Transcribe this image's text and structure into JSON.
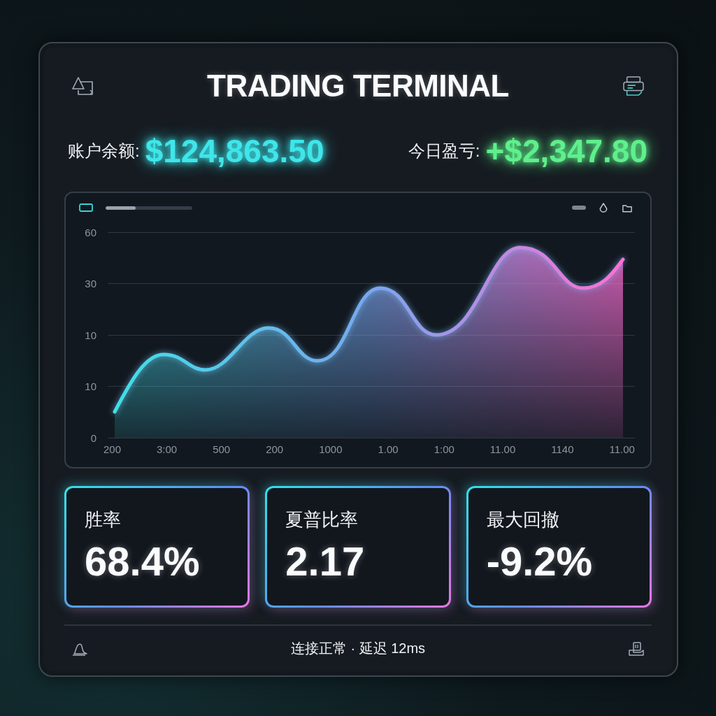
{
  "header": {
    "title": "TRADING TERMINAL"
  },
  "balances": [
    {
      "label": "账户余额:",
      "value": "$124,863.50",
      "color": "#3ee6ea"
    },
    {
      "label": "今日盈亏:",
      "value": "+$2,347.80",
      "color": "#5ef08c"
    }
  ],
  "chart": {
    "progress": {
      "level": 0.35
    },
    "y_labels": [
      "60",
      "30",
      "10",
      "10",
      "0"
    ],
    "x_labels": [
      "200",
      "3:00",
      "500",
      "200",
      "1000",
      "1.00",
      "1:00",
      "11.00",
      "1140",
      "11.00"
    ]
  },
  "stats": [
    {
      "label": "胜率",
      "value": "68.4%"
    },
    {
      "label": "夏普比率",
      "value": "2.17"
    },
    {
      "label": "最大回撤",
      "value": "-9.2%"
    }
  ],
  "status_bar": {
    "text": "连接正常 · 延迟 12ms"
  }
}
